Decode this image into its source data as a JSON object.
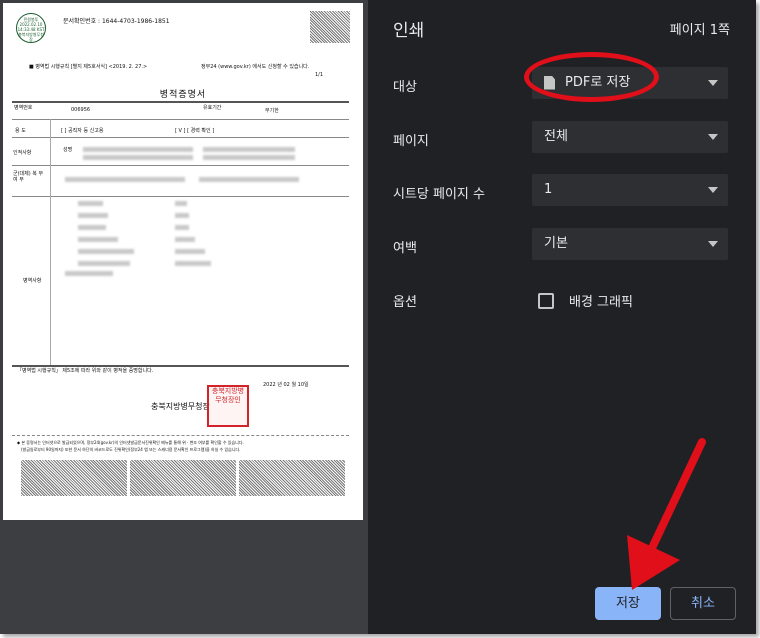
{
  "panel": {
    "title": "인쇄",
    "page_count": "페이지 1쪽",
    "rows": [
      {
        "label": "대상",
        "value": "PDF로 저장",
        "icon": "document-icon"
      },
      {
        "label": "페이지",
        "value": "전체"
      },
      {
        "label": "시트당 페이지 수",
        "value": "1"
      },
      {
        "label": "여백",
        "value": "기본"
      }
    ],
    "options_label": "옵션",
    "background_graphics_label": "배경 그래픽",
    "background_graphics_checked": false,
    "save_button": "저장",
    "cancel_button": "취소"
  },
  "colors": {
    "panel_bg": "#202124",
    "select_bg": "#2e2f33",
    "accent": "#8ab4f8",
    "annotation": "#e00f1a"
  },
  "document": {
    "confirm_no": "문서확인번호 : 1644-4703-1986-1851",
    "form_note": "■ 병역법 시행규칙 [별지 제5호서식] <2019. 2. 27.>",
    "gov_note": "정부24 (www.gov.kr) 에서도 신청할 수 있습니다.",
    "page_num": "1/1",
    "title": "병적증명서",
    "seal_text": "민원봉투 2022.02.10 14:33:48 KST 충북지방병무청장",
    "row_service_no": "병역번호",
    "row_service_no_val": "006956",
    "row_valid": "유효기간",
    "row_valid_val": "무기한",
    "row_purpose": "용   도",
    "row_purpose_val": "[    ] 공직자 등 신고용",
    "row_purpose_val2": "[  V  ] [ 경력 확인 ]",
    "row_personal": "인적사항",
    "row_personal_name": "성명",
    "row_military": "군(대체) 복 무 여 부",
    "row_record": "병역사항",
    "cert_text": "「병역법 시행규칙」 제5조에 따라 위와 같이 병적을 증명합니다.",
    "date": "2022 년 02 월 10일",
    "issuer": "충북지방병무청장",
    "stamp_text": "충북지방병무청장인",
    "footer1": "◆ 본 증명서는 인터넷으로 발급되었으며, 정부24(gov.kr)의 인터넷발급문서진위확인 메뉴를 통해 위 · 변조 여부를 확인할 수 있습니다.",
    "footer2": "(발급일로부터 90일까지) 또한 문서 하단의 바코드로도 진위확인(정부24 앱 또는 스캐너용 문서확인 프로그램)을 하실 수 있습니다."
  }
}
